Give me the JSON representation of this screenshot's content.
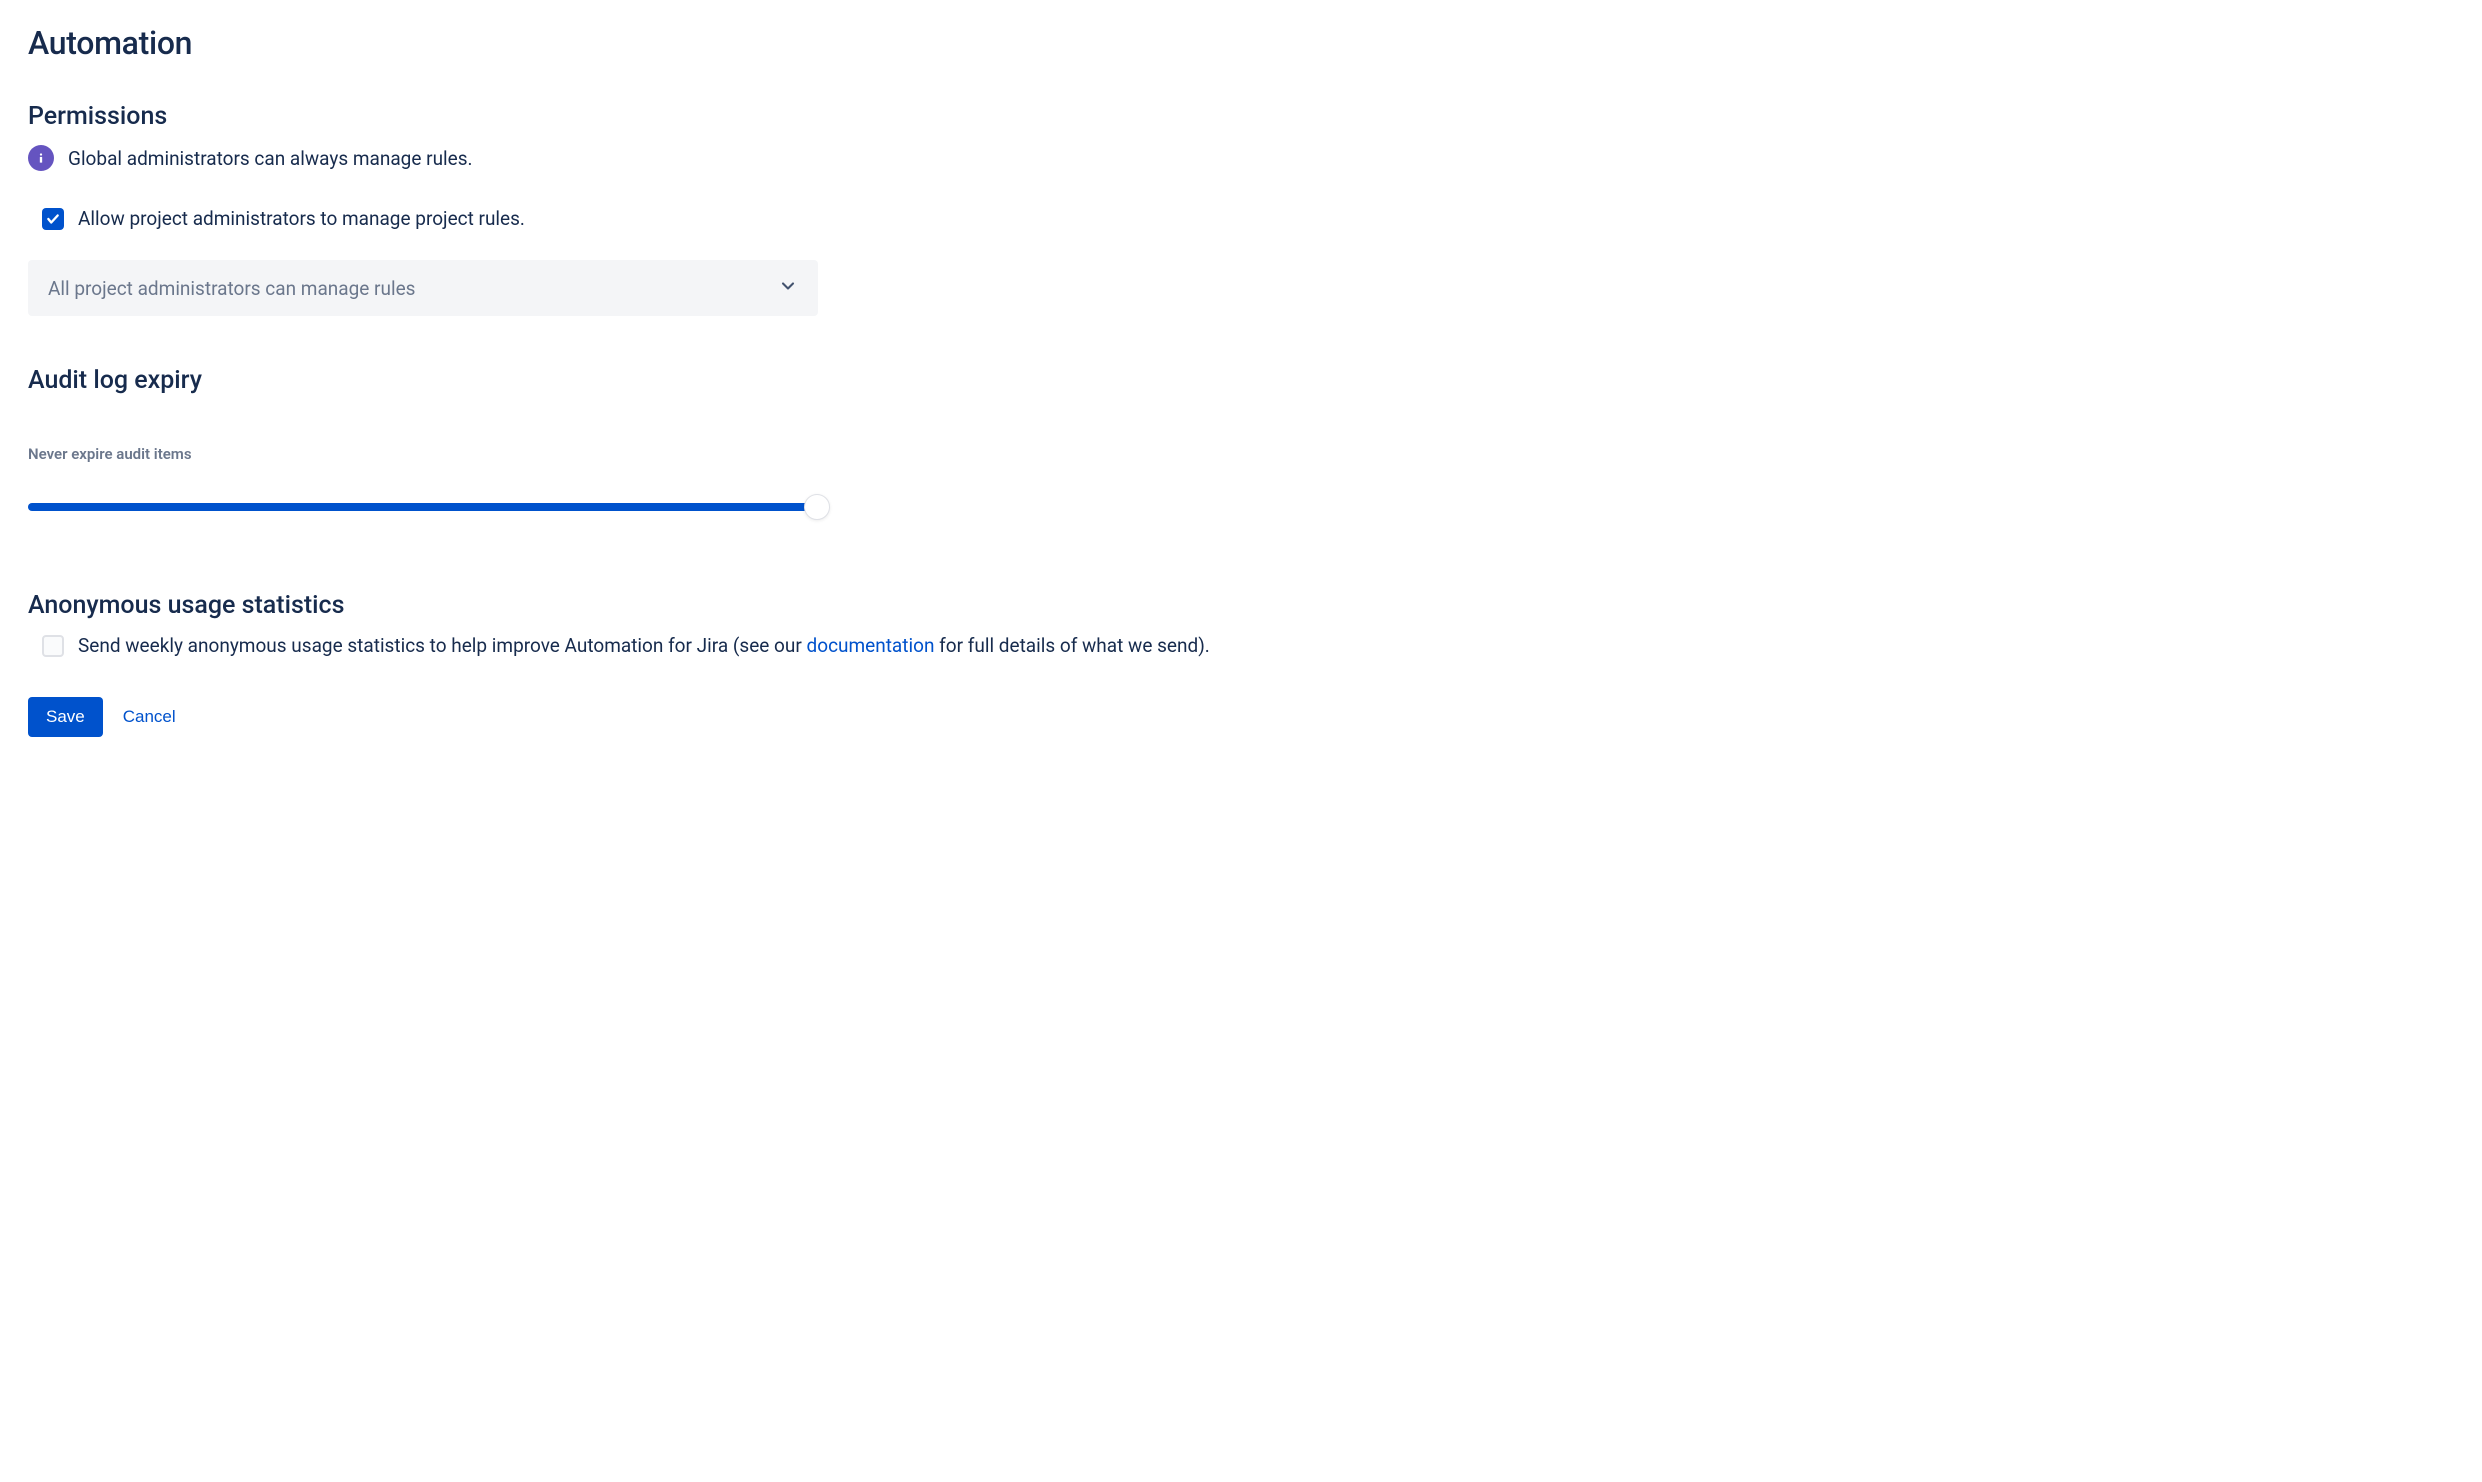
{
  "page": {
    "title": "Automation"
  },
  "permissions": {
    "heading": "Permissions",
    "info_text": "Global administrators can always manage rules.",
    "allow_project_admins": {
      "label": "Allow project administrators to manage project rules.",
      "checked": true
    },
    "select": {
      "value": "All project administrators can manage rules"
    }
  },
  "audit": {
    "heading": "Audit log expiry",
    "slider_label": "Never expire audit items",
    "slider_value": 100
  },
  "stats": {
    "heading": "Anonymous usage statistics",
    "checked": false,
    "text_before": "Send weekly anonymous usage statistics to help improve Automation for Jira (see our ",
    "link_text": "documentation",
    "text_after": " for full details of what we send)."
  },
  "buttons": {
    "save": "Save",
    "cancel": "Cancel"
  }
}
